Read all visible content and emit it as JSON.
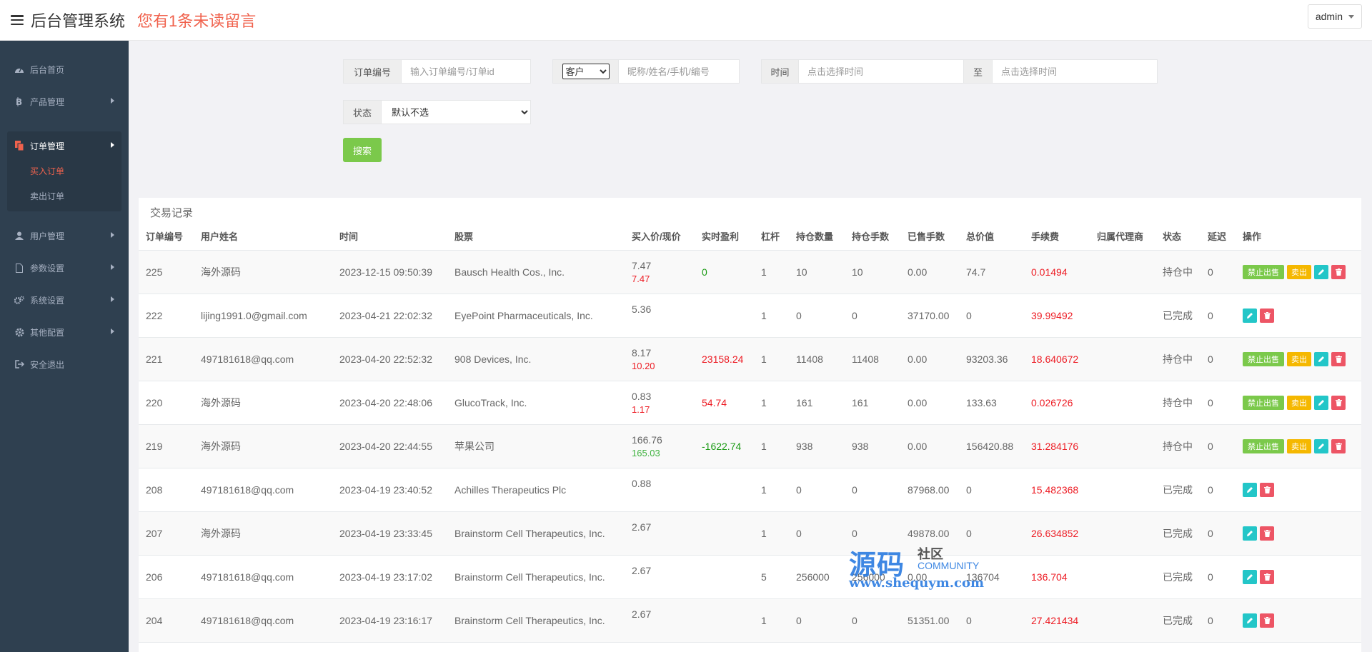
{
  "header": {
    "title": "后台管理系统",
    "notice": "您有1条未读留言",
    "user": "admin"
  },
  "sidebar": {
    "items": [
      {
        "label": "后台首页",
        "icon": "dashboard-icon"
      },
      {
        "label": "产品管理",
        "icon": "bitcoin-icon"
      },
      {
        "label": "订单管理",
        "icon": "copy-icon"
      },
      {
        "label": "用户管理",
        "icon": "user-icon"
      },
      {
        "label": "参数设置",
        "icon": "file-icon"
      },
      {
        "label": "系统设置",
        "icon": "gears-icon"
      },
      {
        "label": "其他配置",
        "icon": "gear-icon"
      },
      {
        "label": "安全退出",
        "icon": "sign-out-icon"
      }
    ],
    "submenu": [
      "买入订单",
      "卖出订单"
    ]
  },
  "search": {
    "order_label": "订单编号",
    "order_placeholder": "输入订单编号/订单id",
    "customer_select": "客户",
    "customer_placeholder": "昵称/姓名/手机/编号",
    "time_label": "时间",
    "time_start_placeholder": "点击选择时间",
    "time_to": "至",
    "time_end_placeholder": "点击选择时间",
    "status_label": "状态",
    "status_selected": "默认不选",
    "search_button": "搜索"
  },
  "panel": {
    "title": "交易记录",
    "columns": [
      "订单编号",
      "用户姓名",
      "时间",
      "股票",
      "买入价/现价",
      "实时盈利",
      "杠杆",
      "持仓数量",
      "持仓手数",
      "已售手数",
      "总价值",
      "手续费",
      "归属代理商",
      "状态",
      "延迟",
      "操作"
    ],
    "buttons": {
      "ban": "禁止出售",
      "sell": "卖出"
    },
    "rows": [
      {
        "id": "225",
        "user": "海外源码",
        "time": "2023-12-15 09:50:39",
        "stock": "Bausch Health Cos., Inc.",
        "buy": "7.47",
        "now": "7.47",
        "now_color": "red",
        "profit": "0",
        "profit_color": "green",
        "leverage": "1",
        "qty": "10",
        "lots": "10",
        "sold": "0.00",
        "total": "74.7",
        "fee": "0.01494",
        "agent": "",
        "status": "持仓中",
        "delay": "0",
        "holding": true
      },
      {
        "id": "222",
        "user": "lijing1991.0@gmail.com",
        "time": "2023-04-21 22:02:32",
        "stock": "EyePoint Pharmaceuticals, Inc.",
        "buy": "5.36",
        "now": "",
        "now_color": "",
        "profit": "",
        "profit_color": "",
        "leverage": "1",
        "qty": "0",
        "lots": "0",
        "sold": "37170.00",
        "total": "0",
        "fee": "39.99492",
        "agent": "",
        "status": "已完成",
        "delay": "0",
        "holding": false
      },
      {
        "id": "221",
        "user": "497181618@qq.com",
        "time": "2023-04-20 22:52:32",
        "stock": "908 Devices, Inc.",
        "buy": "8.17",
        "now": "10.20",
        "now_color": "red",
        "profit": "23158.24",
        "profit_color": "red",
        "leverage": "1",
        "qty": "11408",
        "lots": "11408",
        "sold": "0.00",
        "total": "93203.36",
        "fee": "18.640672",
        "agent": "",
        "status": "持仓中",
        "delay": "0",
        "holding": true
      },
      {
        "id": "220",
        "user": "海外源码",
        "time": "2023-04-20 22:48:06",
        "stock": "GlucoTrack, Inc.",
        "buy": "0.83",
        "now": "1.17",
        "now_color": "red",
        "profit": "54.74",
        "profit_color": "red",
        "leverage": "1",
        "qty": "161",
        "lots": "161",
        "sold": "0.00",
        "total": "133.63",
        "fee": "0.026726",
        "agent": "",
        "status": "持仓中",
        "delay": "0",
        "holding": true
      },
      {
        "id": "219",
        "user": "海外源码",
        "time": "2023-04-20 22:44:55",
        "stock": "苹果公司",
        "buy": "166.76",
        "now": "165.03",
        "now_color": "lightgreen",
        "profit": "-1622.74",
        "profit_color": "green",
        "leverage": "1",
        "qty": "938",
        "lots": "938",
        "sold": "0.00",
        "total": "156420.88",
        "fee": "31.284176",
        "agent": "",
        "status": "持仓中",
        "delay": "0",
        "holding": true
      },
      {
        "id": "208",
        "user": "497181618@qq.com",
        "time": "2023-04-19 23:40:52",
        "stock": "Achilles Therapeutics Plc",
        "buy": "0.88",
        "now": "",
        "now_color": "",
        "profit": "",
        "profit_color": "",
        "leverage": "1",
        "qty": "0",
        "lots": "0",
        "sold": "87968.00",
        "total": "0",
        "fee": "15.482368",
        "agent": "",
        "status": "已完成",
        "delay": "0",
        "holding": false
      },
      {
        "id": "207",
        "user": "海外源码",
        "time": "2023-04-19 23:33:45",
        "stock": "Brainstorm Cell Therapeutics, Inc.",
        "buy": "2.67",
        "now": "",
        "now_color": "",
        "profit": "",
        "profit_color": "",
        "leverage": "1",
        "qty": "0",
        "lots": "0",
        "sold": "49878.00",
        "total": "0",
        "fee": "26.634852",
        "agent": "",
        "status": "已完成",
        "delay": "0",
        "holding": false
      },
      {
        "id": "206",
        "user": "497181618@qq.com",
        "time": "2023-04-19 23:17:02",
        "stock": "Brainstorm Cell Therapeutics, Inc.",
        "buy": "2.67",
        "now": "",
        "now_color": "",
        "profit": "",
        "profit_color": "",
        "leverage": "5",
        "qty": "256000",
        "lots": "256000",
        "sold": "0.00",
        "total": "136704",
        "fee": "136.704",
        "agent": "",
        "status": "已完成",
        "delay": "0",
        "holding": false
      },
      {
        "id": "204",
        "user": "497181618@qq.com",
        "time": "2023-04-19 23:16:17",
        "stock": "Brainstorm Cell Therapeutics, Inc.",
        "buy": "2.67",
        "now": "",
        "now_color": "",
        "profit": "",
        "profit_color": "",
        "leverage": "1",
        "qty": "0",
        "lots": "0",
        "sold": "51351.00",
        "total": "0",
        "fee": "27.421434",
        "agent": "",
        "status": "已完成",
        "delay": "0",
        "holding": false
      }
    ]
  },
  "watermark": {
    "big": "源码",
    "small1": "社区",
    "small2": "COMMUNITY",
    "url": "www.shequym.com"
  },
  "colors": {
    "sidebar_bg": "#2f4050",
    "accent_red": "#f0624d",
    "btn_green": "#7bc94b",
    "btn_yellow": "#f5b800",
    "btn_teal": "#23c6c8",
    "btn_red": "#ed5565"
  }
}
